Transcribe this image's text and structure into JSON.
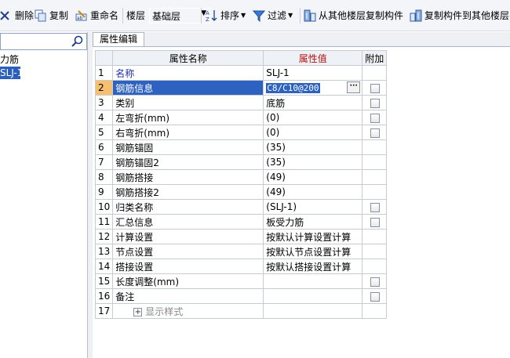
{
  "toolbar": {
    "delete_label": "删除",
    "copy_label": "复制",
    "rename_label": "重命名",
    "floor_label": "楼层",
    "floor_value": "基础层",
    "sort_label": "排序",
    "filter_label": "过滤",
    "copy_from_label": "从其他楼层复制构件",
    "copy_to_label": "复制构件到其他楼层"
  },
  "left_panel": {
    "search_placeholder": "",
    "tree": [
      {
        "label": "力筋"
      },
      {
        "label": "SLJ-1"
      }
    ]
  },
  "tab": {
    "label": "属性编辑"
  },
  "grid": {
    "headers": {
      "name": "属性名称",
      "value": "属性值",
      "attach": "附加"
    },
    "rows": [
      {
        "num": "1",
        "name": "名称",
        "value": "SLJ-1",
        "checkbox": false
      },
      {
        "num": "2",
        "name": "钢筋信息",
        "value": "C8/C10@200",
        "checkbox": true
      },
      {
        "num": "3",
        "name": "类别",
        "value": "底筋",
        "checkbox": true
      },
      {
        "num": "4",
        "name": "左弯折(mm)",
        "value": "(0)",
        "checkbox": true
      },
      {
        "num": "5",
        "name": "右弯折(mm)",
        "value": "(0)",
        "checkbox": true
      },
      {
        "num": "6",
        "name": "钢筋锚固",
        "value": "(35)",
        "checkbox": false
      },
      {
        "num": "7",
        "name": "钢筋锚固2",
        "value": "(35)",
        "checkbox": false
      },
      {
        "num": "8",
        "name": "钢筋搭接",
        "value": "(49)",
        "checkbox": false
      },
      {
        "num": "9",
        "name": "钢筋搭接2",
        "value": "(49)",
        "checkbox": false
      },
      {
        "num": "10",
        "name": "归类名称",
        "value": "(SLJ-1)",
        "checkbox": true
      },
      {
        "num": "11",
        "name": "汇总信息",
        "value": "板受力筋",
        "checkbox": true
      },
      {
        "num": "12",
        "name": "计算设置",
        "value": "按默认计算设置计算",
        "checkbox": false
      },
      {
        "num": "13",
        "name": "节点设置",
        "value": "按默认节点设置计算",
        "checkbox": false
      },
      {
        "num": "14",
        "name": "搭接设置",
        "value": "按默认搭接设置计算",
        "checkbox": false
      },
      {
        "num": "15",
        "name": "长度调整(mm)",
        "value": "",
        "checkbox": true
      },
      {
        "num": "16",
        "name": "备注",
        "value": "",
        "checkbox": true
      },
      {
        "num": "17",
        "name": "显示样式",
        "value": "",
        "checkbox": false
      }
    ]
  }
}
